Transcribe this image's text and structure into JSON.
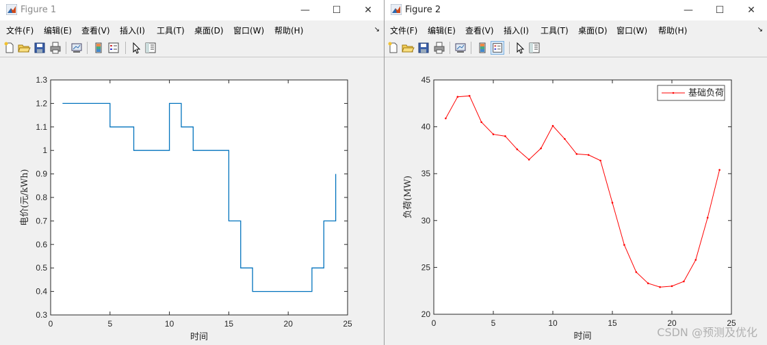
{
  "windows": [
    {
      "title": "Figure 1",
      "menu": [
        "文件(F)",
        "编辑(E)",
        "查看(V)",
        "插入(I)",
        "工具(T)",
        "桌面(D)",
        "窗口(W)",
        "帮助(H)"
      ]
    },
    {
      "title": "Figure 2",
      "menu": [
        "文件(F)",
        "编辑(E)",
        "查看(V)",
        "插入(I)",
        "工具(T)",
        "桌面(D)",
        "窗口(W)",
        "帮助(H)"
      ]
    }
  ],
  "colors": {
    "price_line": "#0072bd",
    "load_line": "#ff0000",
    "titlebar": "#ffffff",
    "background": "#f0f0f0"
  },
  "chart_data": [
    {
      "type": "line",
      "step": "post",
      "title": "",
      "xlabel": "时间",
      "ylabel": "电价(元/kWh)",
      "xlim": [
        0,
        25
      ],
      "ylim": [
        0.3,
        1.3
      ],
      "xticks": [
        0,
        5,
        10,
        15,
        20,
        25
      ],
      "yticks": [
        0.3,
        0.4,
        0.5,
        0.6,
        0.7,
        0.8,
        0.9,
        1,
        1.1,
        1.2,
        1.3
      ],
      "ytick_labels": [
        "0.3",
        "0.4",
        "0.5",
        "0.6",
        "0.7",
        "0.8",
        "0.9",
        "1",
        "1.1",
        "1.2",
        "1.3"
      ],
      "x": [
        1,
        2,
        3,
        4,
        5,
        6,
        7,
        8,
        9,
        10,
        11,
        12,
        13,
        14,
        15,
        16,
        17,
        18,
        19,
        20,
        21,
        22,
        23,
        24
      ],
      "values": [
        1.2,
        1.2,
        1.2,
        1.2,
        1.1,
        1.1,
        1.0,
        1.0,
        1.0,
        1.2,
        1.1,
        1.0,
        1.0,
        1.0,
        0.7,
        0.5,
        0.4,
        0.4,
        0.4,
        0.4,
        0.4,
        0.5,
        0.7,
        0.9
      ],
      "grid": false
    },
    {
      "type": "line",
      "title": "",
      "xlabel": "时间",
      "ylabel": "负荷(MW)",
      "xlim": [
        0,
        25
      ],
      "ylim": [
        20,
        45
      ],
      "xticks": [
        0,
        5,
        10,
        15,
        20,
        25
      ],
      "yticks": [
        20,
        25,
        30,
        35,
        40,
        45
      ],
      "series": [
        {
          "name": "基础负荷",
          "x": [
            1,
            2,
            3,
            4,
            5,
            6,
            7,
            8,
            9,
            10,
            11,
            12,
            13,
            14,
            15,
            16,
            17,
            18,
            19,
            20,
            21,
            22,
            23,
            24
          ],
          "values": [
            40.9,
            43.2,
            43.3,
            40.5,
            39.2,
            39.0,
            37.6,
            36.5,
            37.7,
            40.1,
            38.7,
            37.1,
            37.0,
            36.4,
            31.9,
            27.4,
            24.5,
            23.3,
            22.9,
            23.0,
            23.5,
            25.8,
            30.3,
            35.4
          ]
        }
      ],
      "legend": "top-right",
      "grid": false
    }
  ],
  "watermark": "CSDN @预测及优化"
}
